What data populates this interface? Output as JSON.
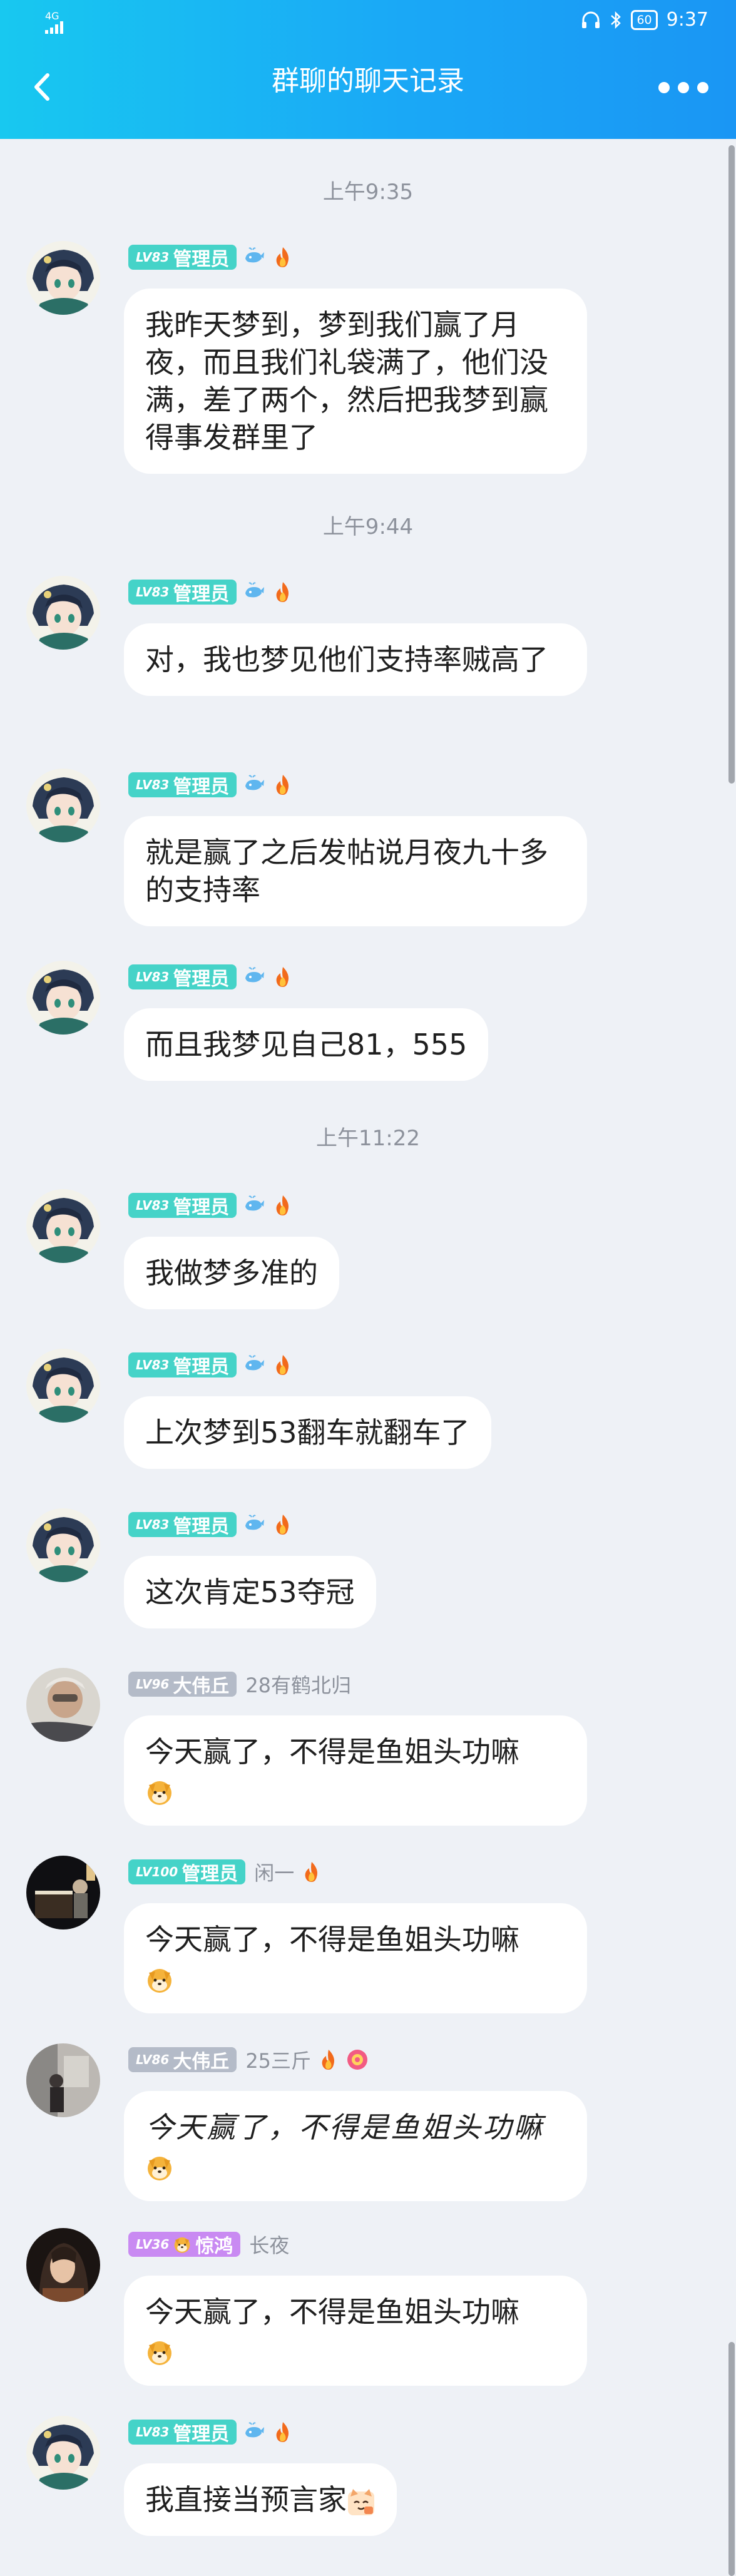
{
  "status": {
    "signal": "4G",
    "battery": "60",
    "time": "9:37"
  },
  "header": {
    "title": "群聊的聊天记录"
  },
  "colors": {
    "admin_badge": "#45d3c8",
    "lv96_badge": "#b4bbc8",
    "lv36_badge": "#c98af2",
    "header": "#1aa8f6"
  },
  "times": [
    "上午9:35",
    "上午9:44",
    "上午11:22"
  ],
  "messages": [
    {
      "badge": {
        "level": "LV83",
        "role": "管理员"
      },
      "nick": "",
      "icons": [
        "whale-icon",
        "fire-icon"
      ],
      "text": "我昨天梦到，梦到我们赢了月夜，而且我们礼袋满了，他们没满，差了两个，然后把我梦到赢得事发群里了"
    },
    {
      "badge": {
        "level": "LV83",
        "role": "管理员"
      },
      "nick": "",
      "icons": [
        "whale-icon",
        "fire-icon"
      ],
      "text": "对，我也梦见他们支持率贼高了"
    },
    {
      "badge": {
        "level": "LV83",
        "role": "管理员"
      },
      "nick": "",
      "icons": [
        "whale-icon",
        "fire-icon"
      ],
      "text": "就是赢了之后发帖说月夜九十多的支持率"
    },
    {
      "badge": {
        "level": "LV83",
        "role": "管理员"
      },
      "nick": "",
      "icons": [
        "whale-icon",
        "fire-icon"
      ],
      "text": "而且我梦见自己81，555"
    },
    {
      "badge": {
        "level": "LV83",
        "role": "管理员"
      },
      "nick": "",
      "icons": [
        "whale-icon",
        "fire-icon"
      ],
      "text": "我做梦多准的"
    },
    {
      "badge": {
        "level": "LV83",
        "role": "管理员"
      },
      "nick": "",
      "icons": [
        "whale-icon",
        "fire-icon"
      ],
      "text": "上次梦到53翻车就翻车了"
    },
    {
      "badge": {
        "level": "LV83",
        "role": "管理员"
      },
      "nick": "",
      "icons": [
        "whale-icon",
        "fire-icon"
      ],
      "text": "这次肯定53夺冠"
    },
    {
      "badge": {
        "level": "LV96",
        "role": "大伟丘"
      },
      "nick": "28有鹤北归",
      "icons": [],
      "text": "今天赢了，不得是鱼姐头功嘛"
    },
    {
      "badge": {
        "level": "LV100",
        "role": "管理员"
      },
      "nick": "闲一",
      "icons": [
        "fire-icon"
      ],
      "text": "今天赢了，不得是鱼姐头功嘛"
    },
    {
      "badge": {
        "level": "LV86",
        "role": "大伟丘"
      },
      "nick": "25三斤",
      "icons": [
        "fire-icon",
        "flower-icon"
      ],
      "text": "今天赢了，不得是鱼姐头功嘛"
    },
    {
      "badge": {
        "level": "LV36",
        "role": "惊鸿"
      },
      "nick": "长夜",
      "icons": [],
      "text": "今天赢了，不得是鱼姐头功嘛"
    },
    {
      "badge": {
        "level": "LV83",
        "role": "管理员"
      },
      "nick": "",
      "icons": [
        "whale-icon",
        "fire-icon"
      ],
      "text": "我直接当预言家"
    }
  ]
}
